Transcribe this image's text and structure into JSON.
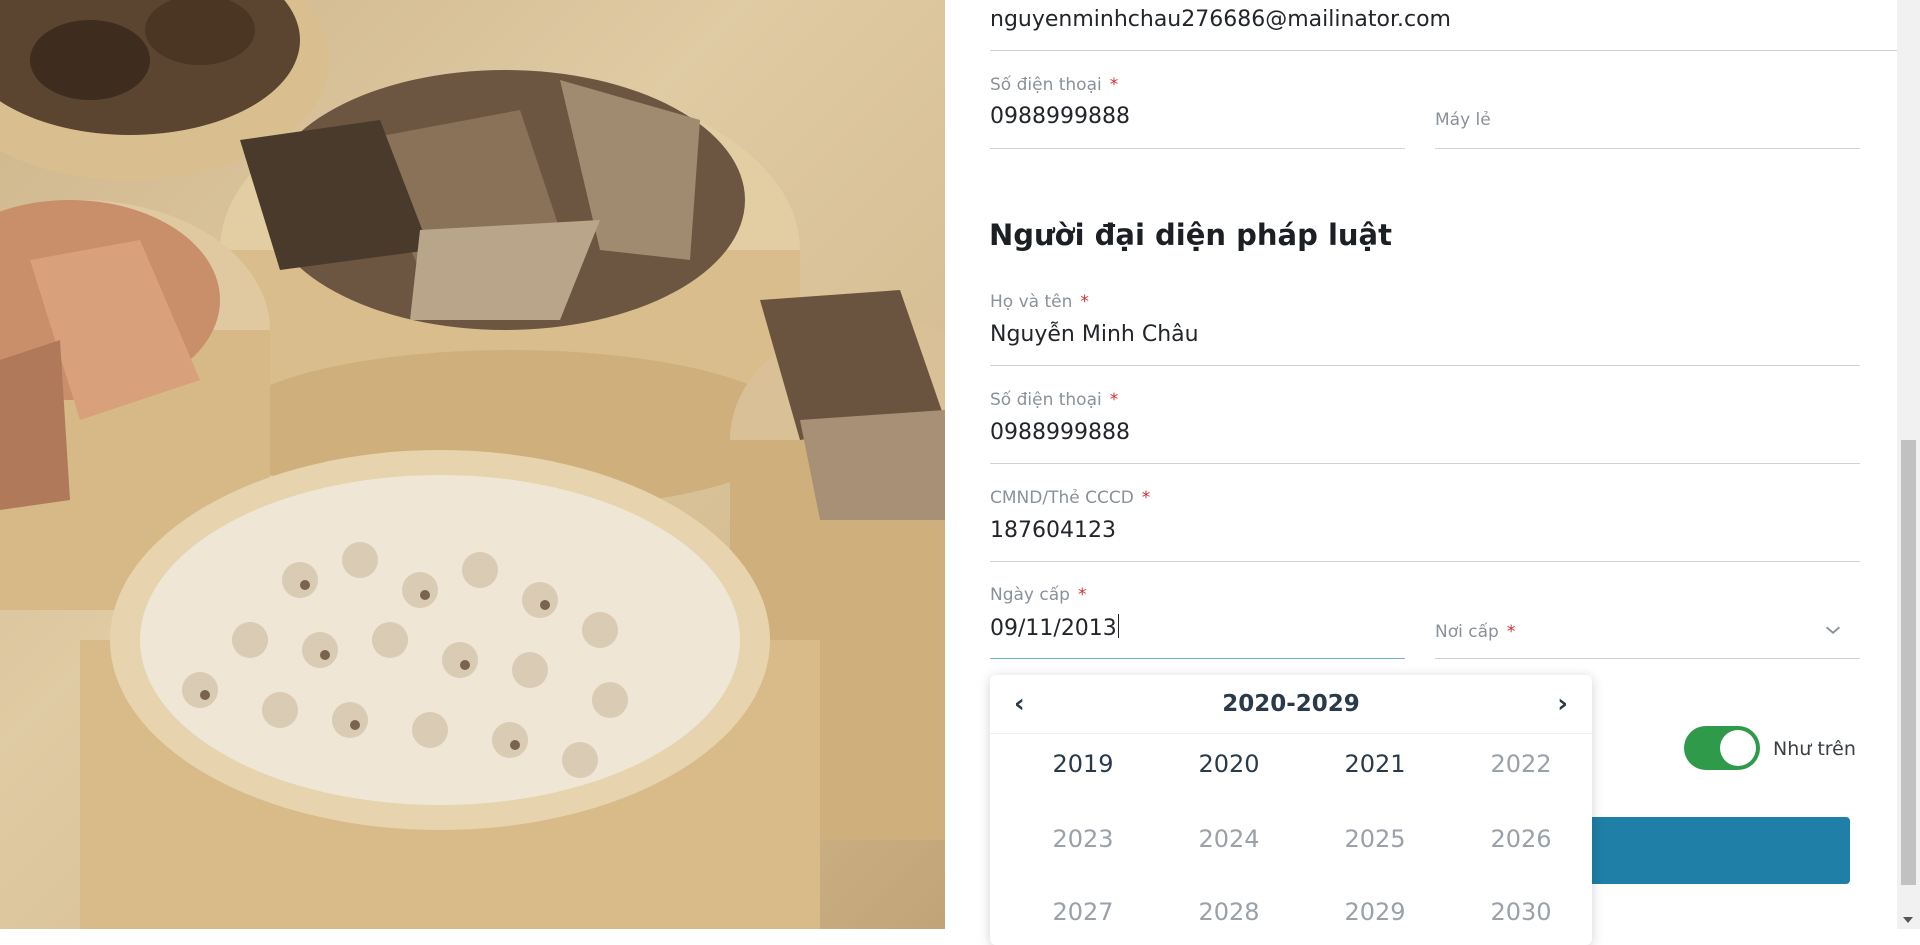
{
  "email": {
    "value": "nguyenminhchau276686@mailinator.com"
  },
  "company_phone": {
    "label": "Số điện thoại",
    "value": "0988999888"
  },
  "extension": {
    "placeholder": "Máy lẻ"
  },
  "legal_rep": {
    "title": "Người đại diện pháp luật",
    "full_name": {
      "label": "Họ và tên",
      "value": "Nguyễn Minh Châu"
    },
    "phone": {
      "label": "Số điện thoại",
      "value": "0988999888"
    },
    "id_number": {
      "label": "CMND/Thẻ CCCD",
      "value": "187604123"
    },
    "issue_date": {
      "label": "Ngày cấp",
      "value": "09/11/2013"
    },
    "issue_place": {
      "label": "Nơi cấp"
    }
  },
  "required_mark": "*",
  "toggle": {
    "label": "Như trên",
    "on": true,
    "color": "#2f9a4a"
  },
  "year_picker": {
    "prev": "‹",
    "next": "›",
    "title": "2020-2029",
    "years": [
      {
        "label": "2019",
        "in_range": true
      },
      {
        "label": "2020",
        "in_range": true
      },
      {
        "label": "2021",
        "in_range": true
      },
      {
        "label": "2022",
        "in_range": false
      },
      {
        "label": "2023",
        "in_range": false
      },
      {
        "label": "2024",
        "in_range": false
      },
      {
        "label": "2025",
        "in_range": false
      },
      {
        "label": "2026",
        "in_range": false
      },
      {
        "label": "2027",
        "in_range": false
      },
      {
        "label": "2028",
        "in_range": false
      },
      {
        "label": "2029",
        "in_range": false
      },
      {
        "label": "2030",
        "in_range": false
      }
    ]
  },
  "colors": {
    "accent": "#1f7fa6",
    "required": "#d32f2f"
  }
}
